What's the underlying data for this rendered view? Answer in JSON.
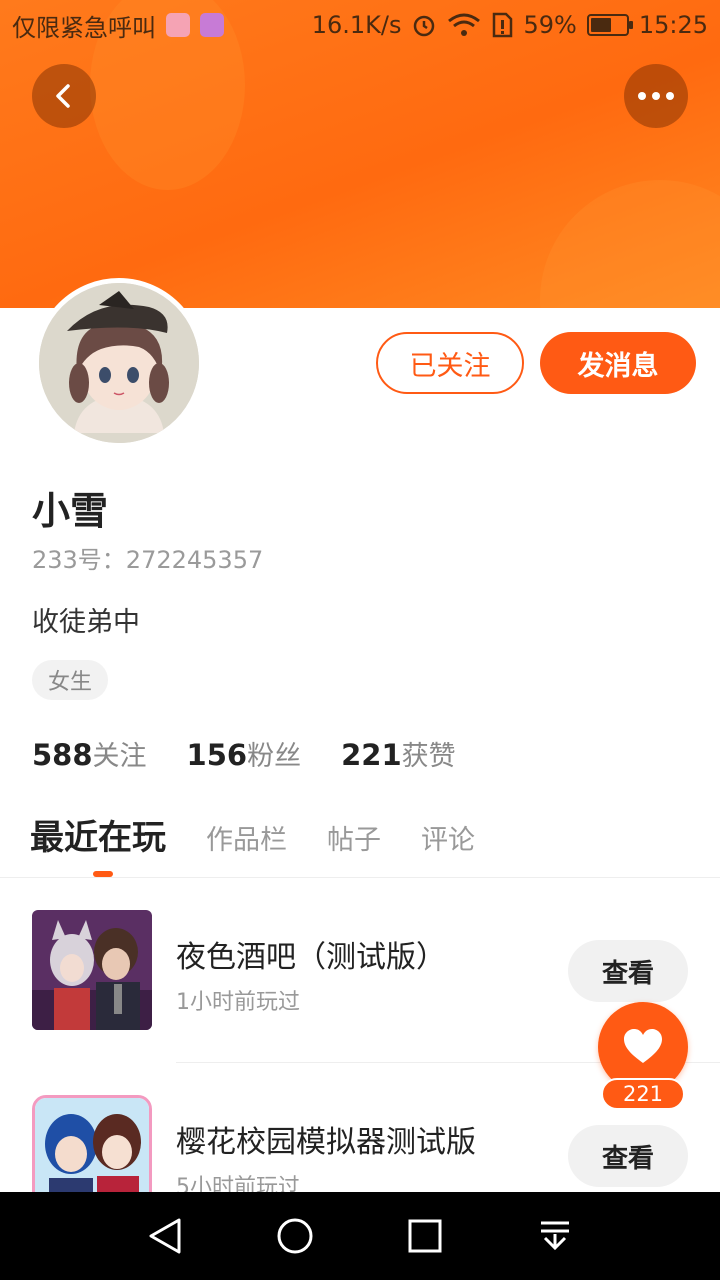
{
  "status_bar": {
    "carrier": "仅限紧急呼叫",
    "speed": "16.1K/s",
    "battery": "59%",
    "battery_level": 0.59,
    "time": "15:25"
  },
  "profile": {
    "name": "小雪",
    "uid": "233号：272245357",
    "bio": "收徒弟中",
    "gender_tag": "女生",
    "followed_label": "已关注",
    "message_label": "发消息"
  },
  "stats": [
    {
      "num": "588",
      "label": "关注"
    },
    {
      "num": "156",
      "label": "粉丝"
    },
    {
      "num": "221",
      "label": "获赞"
    }
  ],
  "tabs": [
    "最近在玩",
    "作品栏",
    "帖子",
    "评论"
  ],
  "games": [
    {
      "title": "夜色酒吧（测试版）",
      "time": "1小时前玩过",
      "button": "查看"
    },
    {
      "title": "樱花校园模拟器测试版",
      "time": "5小时前玩过",
      "button": "查看"
    }
  ],
  "like": {
    "count": "221"
  },
  "colors": {
    "accent": "#ff5a14",
    "header": "#ff7a1c"
  },
  "icons": [
    "back-icon",
    "more-icon",
    "heart-icon",
    "nav-back-icon",
    "nav-home-icon",
    "nav-recents-icon",
    "nav-menu-icon"
  ]
}
